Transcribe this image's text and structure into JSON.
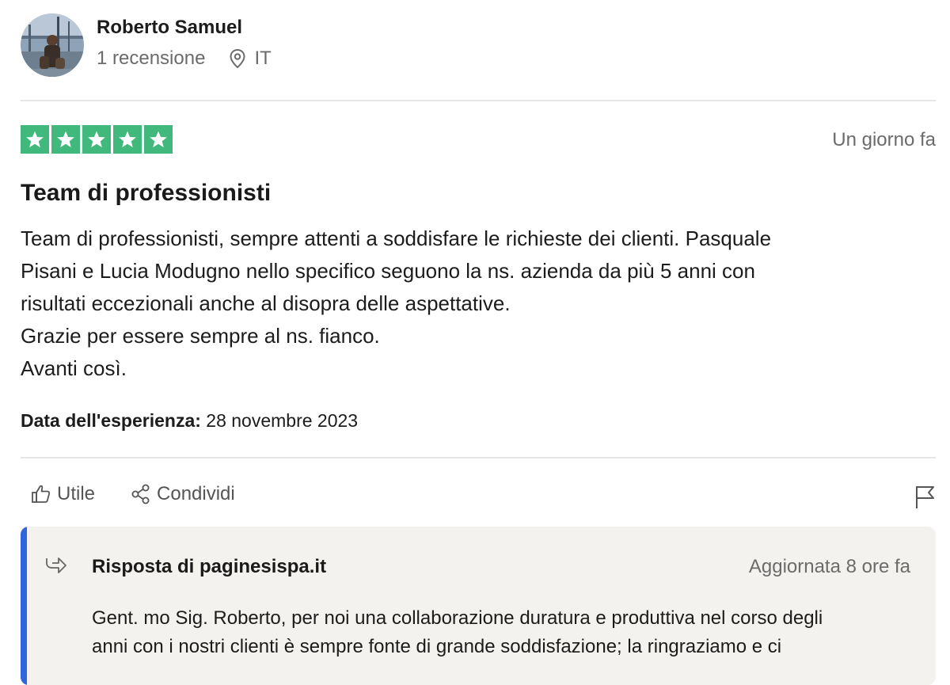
{
  "reviewer": {
    "name": "Roberto Samuel",
    "review_count": "1 recensione",
    "country": "IT",
    "avatar_icon": "user-photo-avatar",
    "location_icon": "location-pin-icon"
  },
  "review": {
    "rating": 5,
    "rating_max": 5,
    "star_color": "#41b97c",
    "date": "Un giorno fa",
    "title": "Team di professionisti",
    "body_lines": [
      "Team di professionisti, sempre attenti a soddisfare le richieste dei clienti. Pasquale",
      "Pisani e Lucia Modugno nello specifico seguono la ns. azienda da più 5 anni con",
      "risultati eccezionali anche al disopra delle aspettative.",
      "Grazie per essere sempre al ns. fianco.",
      "Avanti così."
    ],
    "experience_label": "Data dell'esperienza:",
    "experience_date": "28 novembre 2023"
  },
  "actions": {
    "useful_label": "Utile",
    "share_label": "Condividi",
    "useful_icon": "thumbs-up-icon",
    "share_icon": "share-icon",
    "flag_icon": "flag-icon"
  },
  "reply": {
    "title": "Risposta di paginesispa.it",
    "date": "Aggiornata 8 ore fa",
    "accent_color": "#2f66dc",
    "icon": "reply-arrow-icon",
    "text_lines": [
      "Gent. mo Sig. Roberto, per noi una collaborazione duratura e produttiva nel corso degli",
      "anni con i nostri clienti è sempre fonte di grande soddisfazione; la ringraziamo e ci"
    ]
  }
}
